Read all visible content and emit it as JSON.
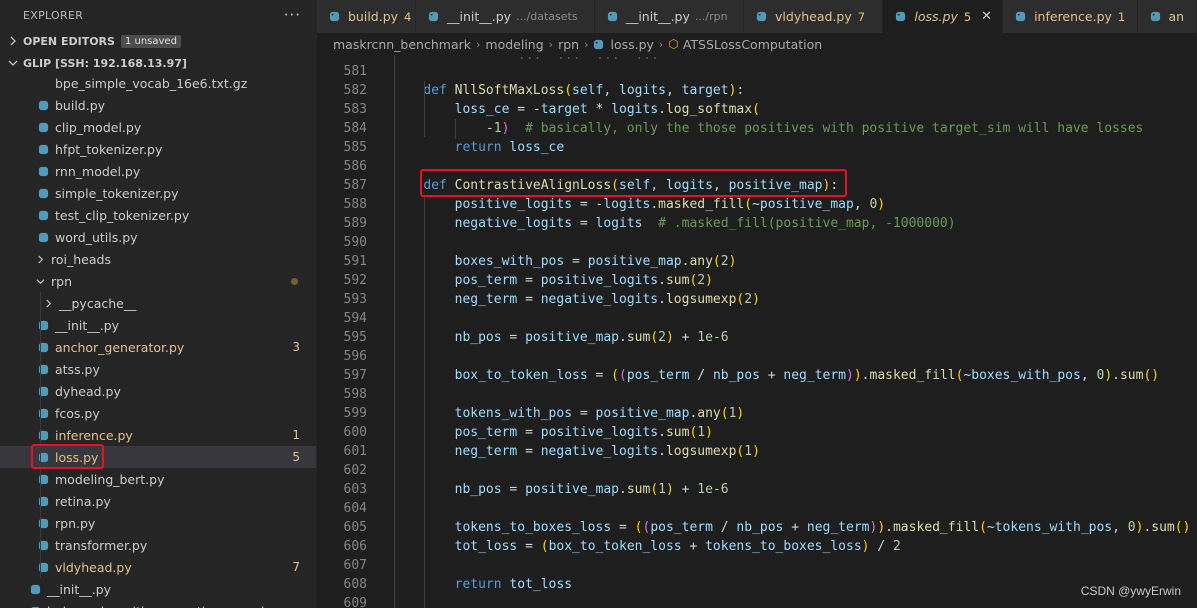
{
  "explorer": {
    "title": "EXPLORER",
    "more": "···",
    "open_editors": "OPEN EDITORS",
    "unsaved_badge": "1 unsaved",
    "workspace": "GLIP [SSH: 192.168.13.97]"
  },
  "tree": [
    {
      "label": "bpe_simple_vocab_16e6.txt.gz",
      "type": "file-plain"
    },
    {
      "label": "build.py",
      "type": "py"
    },
    {
      "label": "clip_model.py",
      "type": "py"
    },
    {
      "label": "hfpt_tokenizer.py",
      "type": "py"
    },
    {
      "label": "rnn_model.py",
      "type": "py"
    },
    {
      "label": "simple_tokenizer.py",
      "type": "py"
    },
    {
      "label": "test_clip_tokenizer.py",
      "type": "py"
    },
    {
      "label": "word_utils.py",
      "type": "py"
    },
    {
      "label": "roi_heads",
      "type": "folder-closed"
    },
    {
      "label": "rpn",
      "type": "folder-open"
    },
    {
      "label": "__pycache__",
      "type": "folder-closed"
    },
    {
      "label": "__init__.py",
      "type": "py"
    },
    {
      "label": "anchor_generator.py",
      "type": "py",
      "count": "3"
    },
    {
      "label": "atss.py",
      "type": "py"
    },
    {
      "label": "dyhead.py",
      "type": "py"
    },
    {
      "label": "fcos.py",
      "type": "py"
    },
    {
      "label": "inference.py",
      "type": "py",
      "count": "1"
    },
    {
      "label": "loss.py",
      "type": "py",
      "count": "5"
    },
    {
      "label": "modeling_bert.py",
      "type": "py"
    },
    {
      "label": "retina.py",
      "type": "py"
    },
    {
      "label": "rpn.py",
      "type": "py"
    },
    {
      "label": "transformer.py",
      "type": "py"
    },
    {
      "label": "vldyhead.py",
      "type": "py",
      "count": "7"
    },
    {
      "label": "__init__.py",
      "type": "py"
    },
    {
      "label": "balanced_positive_negative_sampler.py",
      "type": "py"
    }
  ],
  "tabs": [
    {
      "name": "build.py",
      "num": "4",
      "dot": true
    },
    {
      "name": "__init__.py",
      "path": ".../datasets"
    },
    {
      "name": "__init__.py",
      "path": ".../rpn"
    },
    {
      "name": "vldyhead.py",
      "num": "7"
    },
    {
      "name": "loss.py",
      "num": "5",
      "close": "✕"
    },
    {
      "name": "inference.py",
      "num": "1"
    },
    {
      "name": "an"
    }
  ],
  "breadcrumb": {
    "items": [
      "maskrcnn_benchmark",
      "modeling",
      "rpn",
      "loss.py"
    ],
    "symbol": "ATSSLossComputation"
  },
  "code": {
    "top_partial": "            ...  ...  ...  ...",
    "lines": [
      {
        "n": "581",
        "text": ""
      },
      {
        "n": "582",
        "text": "    def NllSoftMaxLoss(self, logits, target):"
      },
      {
        "n": "583",
        "text": "        loss_ce = -target * logits.log_softmax("
      },
      {
        "n": "584",
        "text": "            -1)  # basically, only the those positives with positive target_sim will have losses"
      },
      {
        "n": "585",
        "text": "        return loss_ce"
      },
      {
        "n": "586",
        "text": ""
      },
      {
        "n": "587",
        "text": "    def ContrastiveAlignLoss(self, logits, positive_map):"
      },
      {
        "n": "588",
        "text": "        positive_logits = -logits.masked_fill(~positive_map, 0)"
      },
      {
        "n": "589",
        "text": "        negative_logits = logits  # .masked_fill(positive_map, -1000000)"
      },
      {
        "n": "590",
        "text": ""
      },
      {
        "n": "591",
        "text": "        boxes_with_pos = positive_map.any(2)"
      },
      {
        "n": "592",
        "text": "        pos_term = positive_logits.sum(2)"
      },
      {
        "n": "593",
        "text": "        neg_term = negative_logits.logsumexp(2)"
      },
      {
        "n": "594",
        "text": ""
      },
      {
        "n": "595",
        "text": "        nb_pos = positive_map.sum(2) + 1e-6"
      },
      {
        "n": "596",
        "text": ""
      },
      {
        "n": "597",
        "text": "        box_to_token_loss = ((pos_term / nb_pos + neg_term)).masked_fill(~boxes_with_pos, 0).sum()"
      },
      {
        "n": "598",
        "text": ""
      },
      {
        "n": "599",
        "text": "        tokens_with_pos = positive_map.any(1)"
      },
      {
        "n": "600",
        "text": "        pos_term = positive_logits.sum(1)"
      },
      {
        "n": "601",
        "text": "        neg_term = negative_logits.logsumexp(1)"
      },
      {
        "n": "602",
        "text": ""
      },
      {
        "n": "603",
        "text": "        nb_pos = positive_map.sum(1) + 1e-6"
      },
      {
        "n": "604",
        "text": ""
      },
      {
        "n": "605",
        "text": "        tokens_to_boxes_loss = ((pos_term / nb_pos + neg_term)).masked_fill(~tokens_with_pos, 0).sum()"
      },
      {
        "n": "606",
        "text": "        tot_loss = (box_to_token_loss + tokens_to_boxes_loss) / 2"
      },
      {
        "n": "607",
        "text": ""
      },
      {
        "n": "608",
        "text": "        return tot_loss"
      },
      {
        "n": "609",
        "text": ""
      }
    ]
  },
  "watermark": "CSDN @ywyErwin",
  "colors": {
    "highlight_box": "#e81123",
    "python_icon": "#519aba",
    "modified": "#e2c08d"
  }
}
